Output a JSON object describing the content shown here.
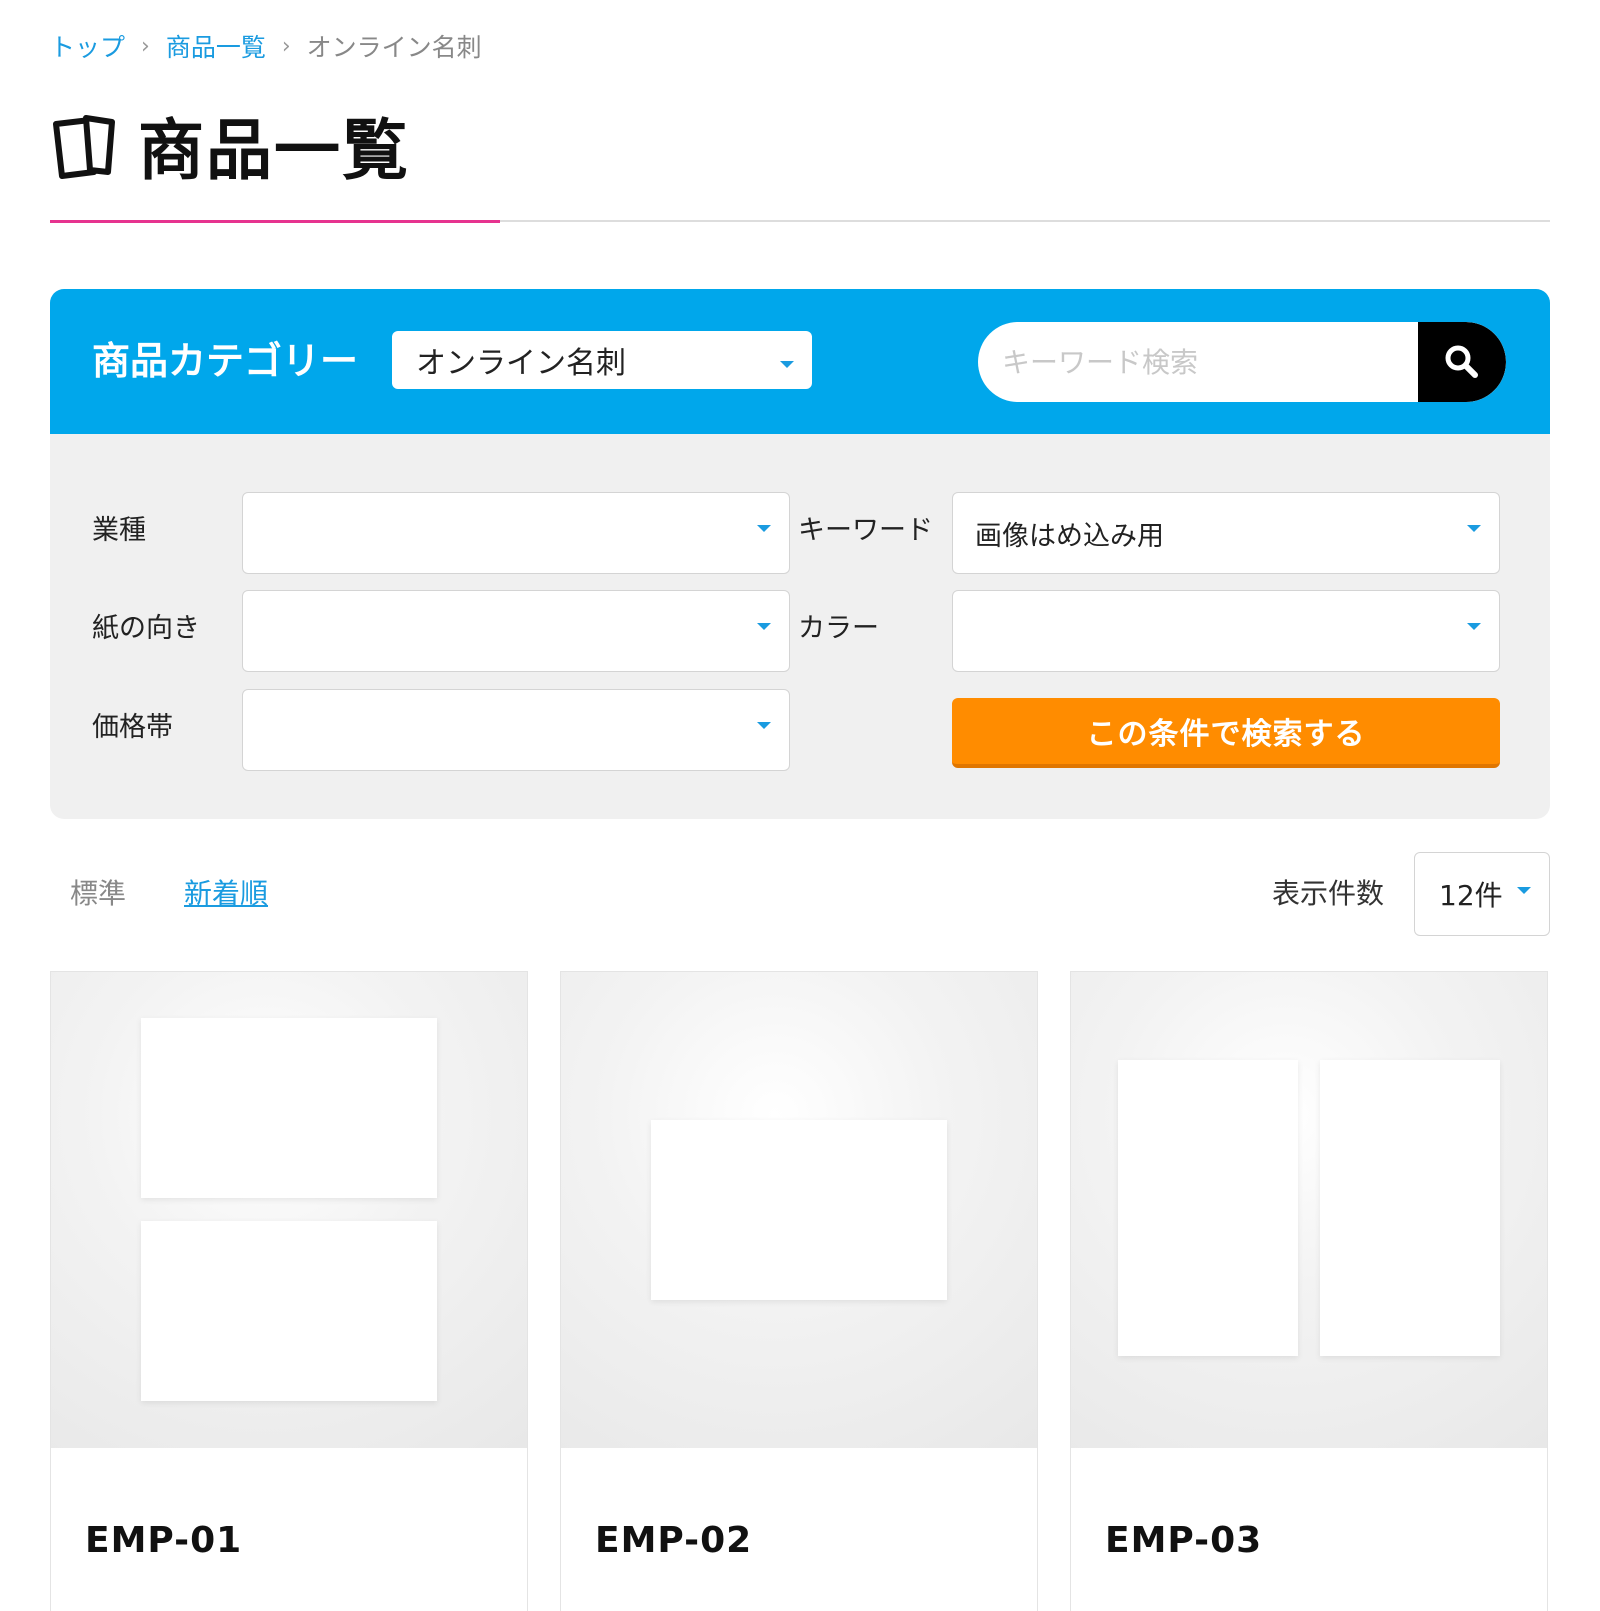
{
  "breadcrumb": {
    "top": "トップ",
    "list": "商品一覧",
    "current": "オンライン名刺",
    "separator": ">"
  },
  "page": {
    "title": "商品一覧",
    "accent_color": "#e6338f"
  },
  "search_panel": {
    "category_label": "商品カテゴリー",
    "category_value": "オンライン名刺",
    "keyword_placeholder": "キーワード検索",
    "header_color": "#00a7eb",
    "filters": {
      "industry_label": "業種",
      "industry_value": "",
      "keyword_label": "キーワード",
      "keyword_value": "画像はめ込み用",
      "orientation_label": "紙の向き",
      "orientation_value": "",
      "color_label": "カラー",
      "color_value": "",
      "price_label": "価格帯",
      "price_value": ""
    },
    "submit_label": "この条件で検索する",
    "submit_color": "#ff8c00"
  },
  "sort": {
    "standard": "標準",
    "newest": "新着順"
  },
  "display_count": {
    "label": "表示件数",
    "value": "12件"
  },
  "products": [
    {
      "code": "EMP-01"
    },
    {
      "code": "EMP-02"
    },
    {
      "code": "EMP-03"
    }
  ]
}
